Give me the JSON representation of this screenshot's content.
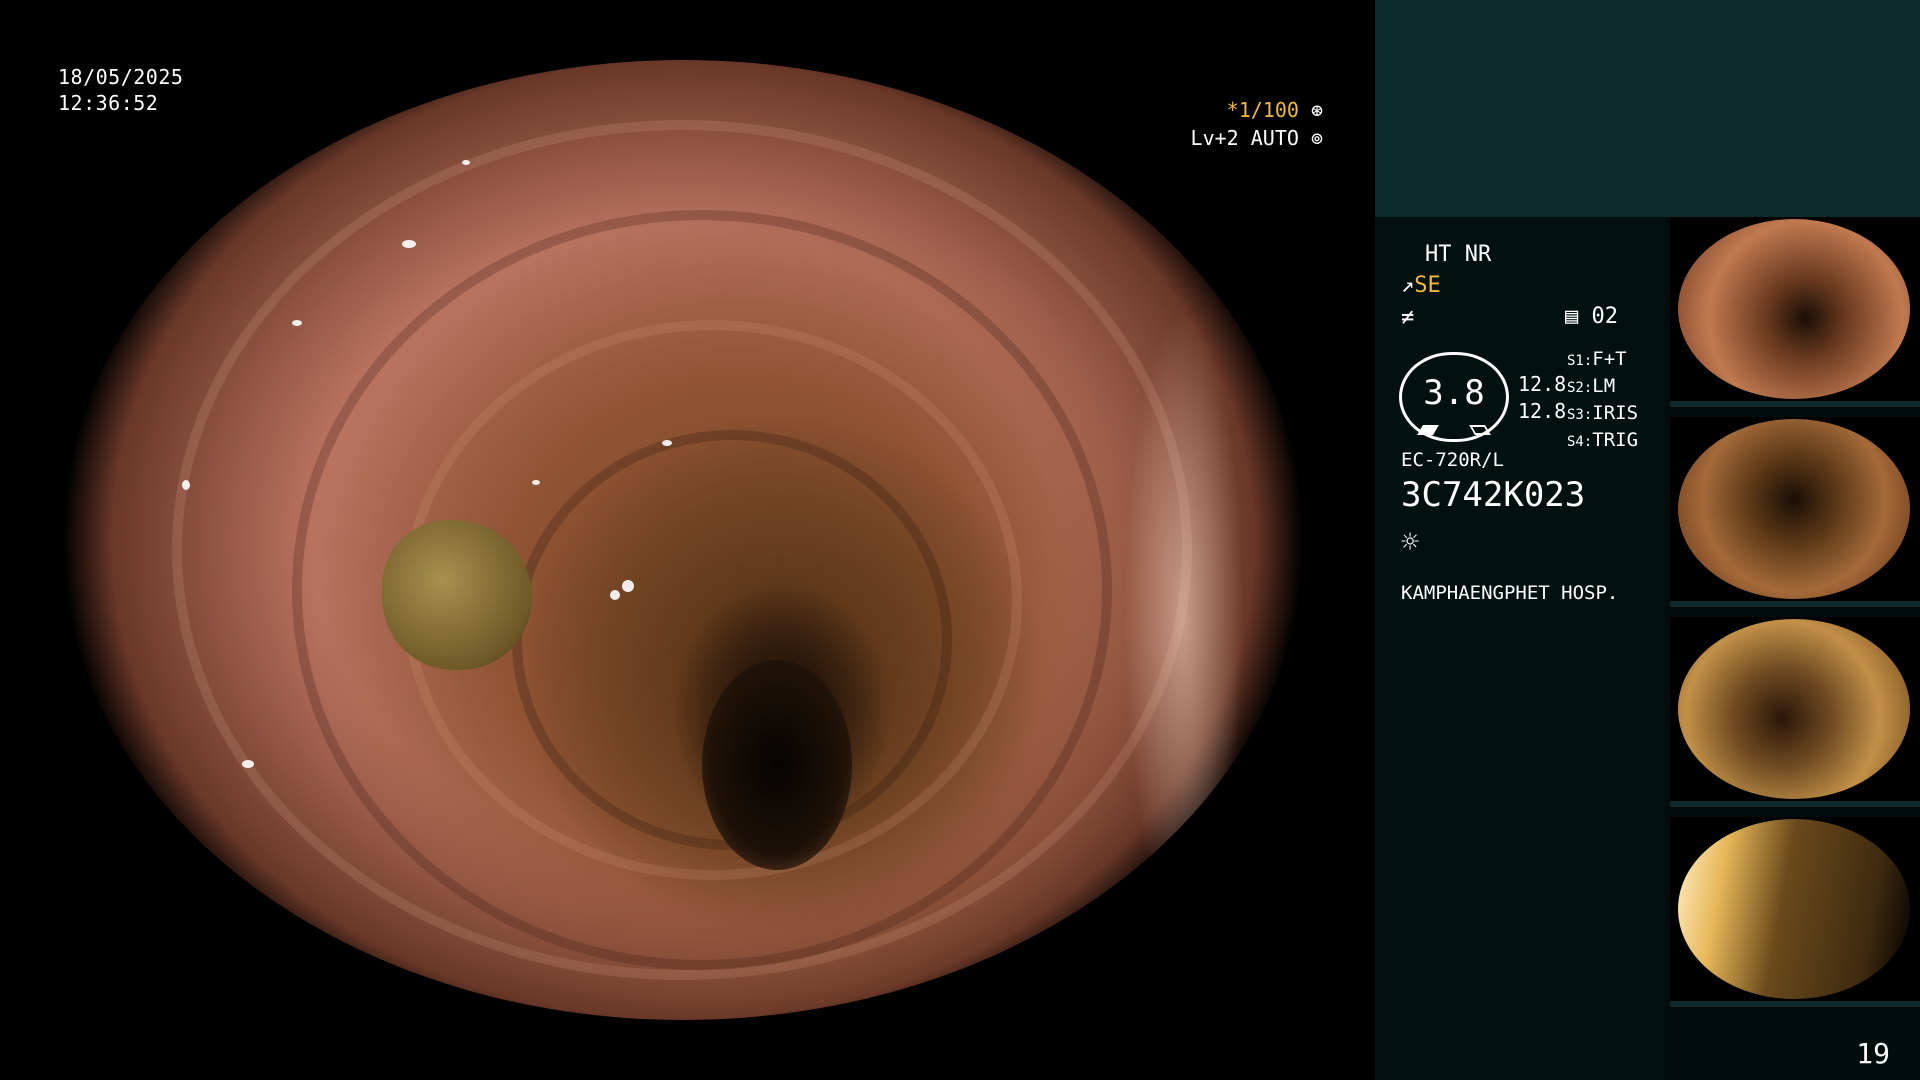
{
  "datetime": {
    "date": "18/05/2025",
    "time": "12:36:52"
  },
  "osd": {
    "shutter": "*1/100",
    "shutter_icon": "aperture-icon",
    "level": "Lv+2 AUTO",
    "level_icon": "iris-icon"
  },
  "panel": {
    "mode": "HT NR",
    "enhancement": "SE",
    "enhancement_icon": "enhancement-icon",
    "freeze_icon": "freeze-icon",
    "memory_icon": "memory-card-icon",
    "memory_count": "02",
    "gauge_value": "3.8",
    "scale_top": "12.8",
    "scale_bottom": "12.8",
    "switches": [
      {
        "key": "S1",
        "value": "F+T"
      },
      {
        "key": "S2",
        "value": "LM"
      },
      {
        "key": "S3",
        "value": "IRIS"
      },
      {
        "key": "S4",
        "value": "TRIG"
      }
    ],
    "scope_model": "EC-720R/L",
    "serial": "3C742K023",
    "light_icon": "light-icon",
    "hospital": "KAMPHAENGPHET HOSP."
  },
  "thumbnails": [
    {
      "label": "thumbnail-1"
    },
    {
      "label": "thumbnail-2"
    },
    {
      "label": "thumbnail-3"
    },
    {
      "label": "thumbnail-4"
    }
  ],
  "page_number": "19",
  "colors": {
    "accent": "#f5b93a",
    "panel_bg": "#0c2a29"
  }
}
